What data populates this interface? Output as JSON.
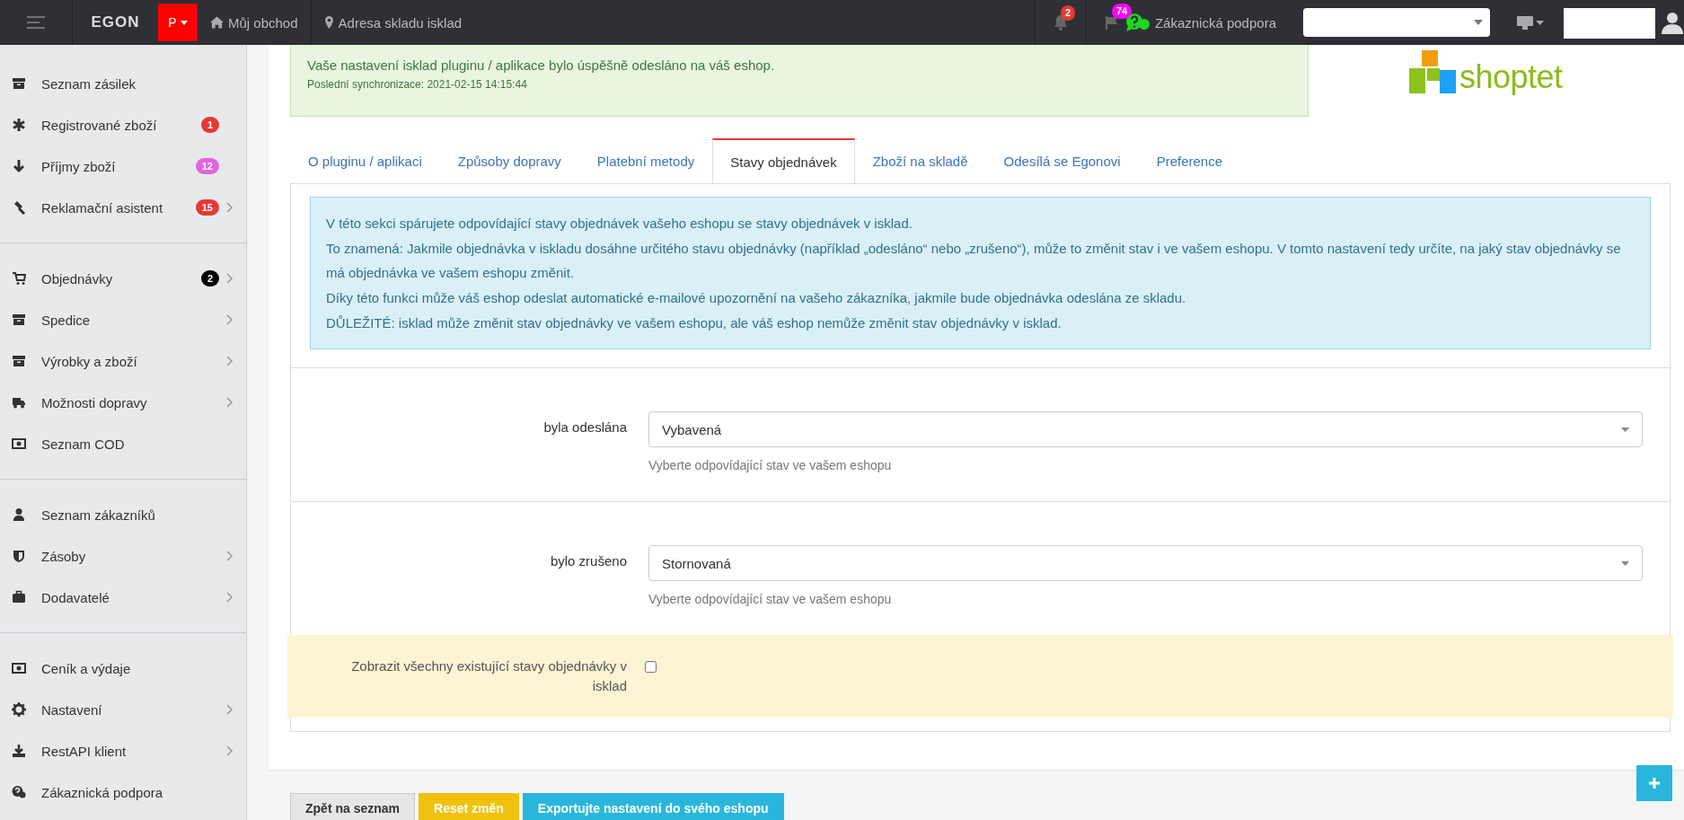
{
  "topbar": {
    "logo": "EGON",
    "shop_button": "P",
    "links": [
      {
        "kind": "home",
        "label": "Můj obchod"
      },
      {
        "kind": "marker",
        "label": "Adresa skladu isklad"
      }
    ],
    "notifications": "2",
    "messages": "74",
    "support": "Zákaznická podpora"
  },
  "sidebar": {
    "groups": [
      {
        "items": [
          {
            "kind": "archive",
            "label": "Seznam zásilek",
            "expandable": false
          },
          {
            "kind": "asterisk",
            "label": "Registrované zboží",
            "badge": "1",
            "color": "#e53935",
            "expandable": false
          },
          {
            "kind": "arrow-down",
            "label": "Příjmy zboží",
            "badge": "12",
            "color": "#e066e0",
            "expandable": false
          },
          {
            "kind": "gavel",
            "label": "Reklamační asistent",
            "badge": "15",
            "color": "#e53935",
            "expandable": true
          }
        ]
      },
      {
        "items": [
          {
            "kind": "cart",
            "label": "Objednávky",
            "badge": "2",
            "color": "#000000",
            "expandable": true
          },
          {
            "kind": "archive",
            "label": "Spedice",
            "expandable": true
          },
          {
            "kind": "archive",
            "label": "Výrobky a zboží",
            "expandable": true
          },
          {
            "kind": "truck",
            "label": "Možnosti dopravy",
            "expandable": true
          },
          {
            "kind": "money",
            "label": "Seznam COD",
            "expandable": false
          }
        ]
      },
      {
        "items": [
          {
            "kind": "user",
            "label": "Seznam zákazníků",
            "expandable": false
          },
          {
            "kind": "shield",
            "label": "Zásoby",
            "expandable": true
          },
          {
            "kind": "briefcase",
            "label": "Dodavatelé",
            "expandable": true
          }
        ]
      },
      {
        "items": [
          {
            "kind": "money",
            "label": "Ceník a výdaje",
            "expandable": false
          },
          {
            "kind": "gear",
            "label": "Nastavení",
            "expandable": true
          },
          {
            "kind": "download",
            "label": "RestAPI klient",
            "expandable": true
          },
          {
            "kind": "question",
            "label": "Zákaznická podpora",
            "expandable": false
          }
        ]
      }
    ]
  },
  "alert": {
    "message": "Vaše nastavení isklad pluginu / aplikace bylo úspěšně odesláno na váš eshop.",
    "sync": "Poslední synchronizace: 2021-02-15 14:15:44"
  },
  "brand": {
    "name": "shoptet"
  },
  "tabs": [
    {
      "label": "O pluginu / aplikaci",
      "selected": false
    },
    {
      "label": "Způsoby dopravy",
      "selected": false
    },
    {
      "label": "Platební metody",
      "selected": false
    },
    {
      "label": "Stavy objednávek",
      "selected": true
    },
    {
      "label": "Zboží na skladě",
      "selected": false
    },
    {
      "label": "Odesílá se Egonovi",
      "selected": false
    },
    {
      "label": "Preference",
      "selected": false
    }
  ],
  "info": {
    "paragraphs": [
      "V této sekci spárujete odpovídající stavy objednávek vašeho eshopu se stavy objednávek v isklad.",
      "To znamená: Jakmile objednávka v iskladu dosáhne určitého stavu objednávky (například „odesláno“ nebo „zrušeno“), může to změnit stav i ve vašem eshopu. V tomto nastavení tedy určíte, na jaký stav objednávky se má objednávka ve vašem eshopu změnit.",
      "Díky této funkci může váš eshop odeslat automatické e-mailové upozornění na vašeho zákazníka, jakmile bude objednávka odeslána ze skladu.",
      "DŮLEŽITÉ: isklad může změnit stav objednávky ve vašem eshopu, ale váš eshop nemůže změnit stav objednávky v isklad."
    ]
  },
  "fields": [
    {
      "label": "byla odeslána",
      "value": "Vybavená",
      "help": "Vyberte odpovídající stav ve vašem eshopu"
    },
    {
      "label": "bylo zrušeno",
      "value": "Stornovaná",
      "help": "Vyberte odpovídající stav ve vašem eshopu"
    }
  ],
  "option": {
    "label": "Zobrazit všechny existující stavy objednávky v isklad",
    "checked": false
  },
  "buttons": [
    {
      "label": "Zpět na seznam",
      "kind": "default"
    },
    {
      "label": "Reset změn",
      "kind": "warning"
    },
    {
      "label": "Exportujte nastavení do svého eshopu",
      "kind": "info"
    }
  ]
}
